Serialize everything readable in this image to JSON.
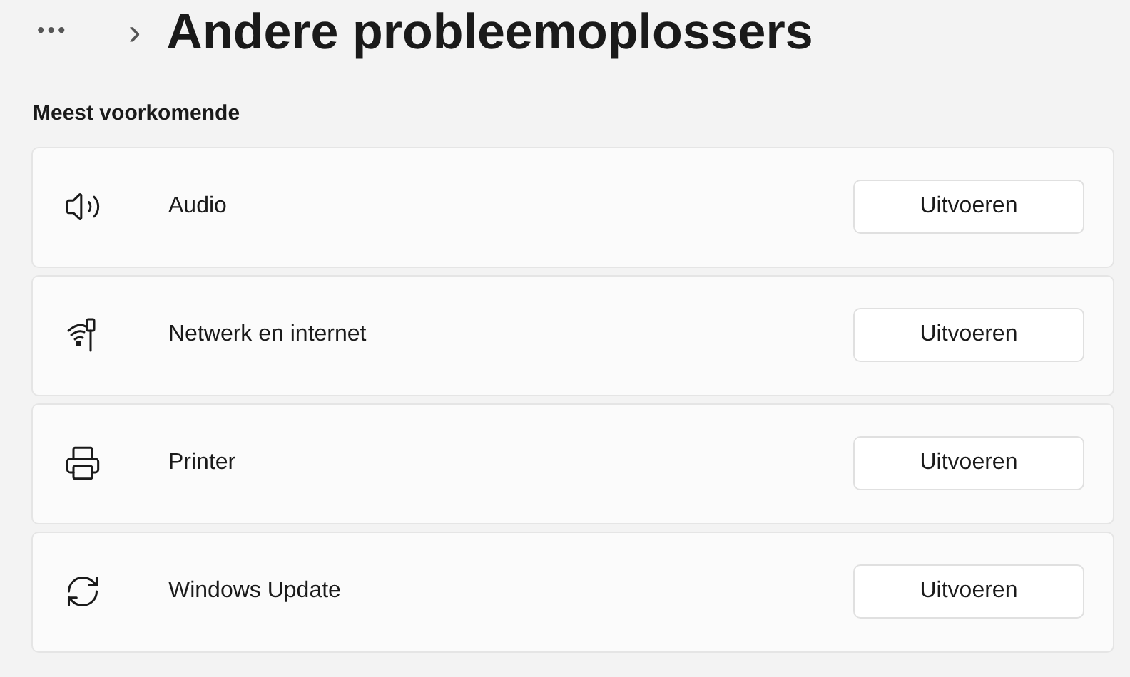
{
  "breadcrumb": {
    "more": "•••",
    "separator": "›",
    "title": "Andere probleemoplossers"
  },
  "section": {
    "heading": "Meest voorkomende"
  },
  "troubleshooters": [
    {
      "kind": "audio",
      "label": "Audio",
      "button": "Uitvoeren"
    },
    {
      "kind": "network",
      "label": "Netwerk en internet",
      "button": "Uitvoeren"
    },
    {
      "kind": "printer",
      "label": "Printer",
      "button": "Uitvoeren"
    },
    {
      "kind": "update",
      "label": "Windows Update",
      "button": "Uitvoeren"
    }
  ]
}
